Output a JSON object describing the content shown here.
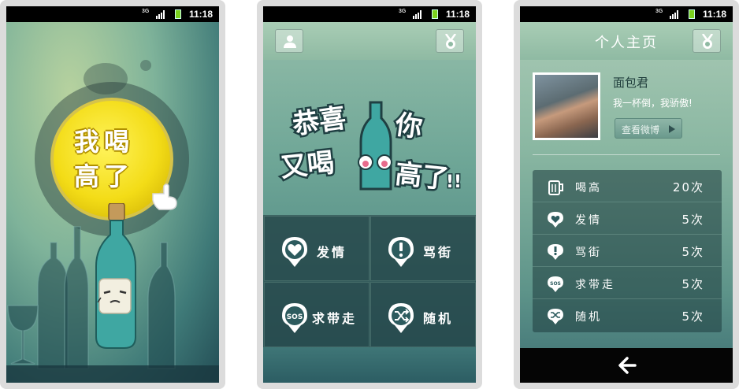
{
  "status_bar": {
    "network": "3G",
    "time": "11:18"
  },
  "screen1": {
    "logo_line1": "我喝",
    "logo_line2": "高了"
  },
  "screen2": {
    "banner_text": "恭喜你又喝高了!!",
    "menu": [
      {
        "label": "发情",
        "icon": "heart-pin-icon"
      },
      {
        "label": "骂街",
        "icon": "exclamation-pin-icon"
      },
      {
        "label": "求带走",
        "icon": "sos-pin-icon"
      },
      {
        "label": "随机",
        "icon": "shuffle-pin-icon"
      }
    ]
  },
  "screen3": {
    "title": "个人主页",
    "user_name": "面包君",
    "user_status": "我一杯倒，我骄傲!",
    "weibo_button": "查看微博",
    "stats": [
      {
        "label": "喝高",
        "count": "20次",
        "icon": "beer-mug-icon"
      },
      {
        "label": "发情",
        "count": "5次",
        "icon": "heart-pin-icon"
      },
      {
        "label": "骂街",
        "count": "5次",
        "icon": "exclamation-pin-icon"
      },
      {
        "label": "求带走",
        "count": "5次",
        "icon": "sos-pin-icon"
      },
      {
        "label": "随机",
        "count": "5次",
        "icon": "shuffle-pin-icon"
      }
    ]
  },
  "colors": {
    "accent_yellow": "#f3dc17",
    "bottle_teal": "#3fa7a2",
    "panel_dark": "#234d55"
  }
}
